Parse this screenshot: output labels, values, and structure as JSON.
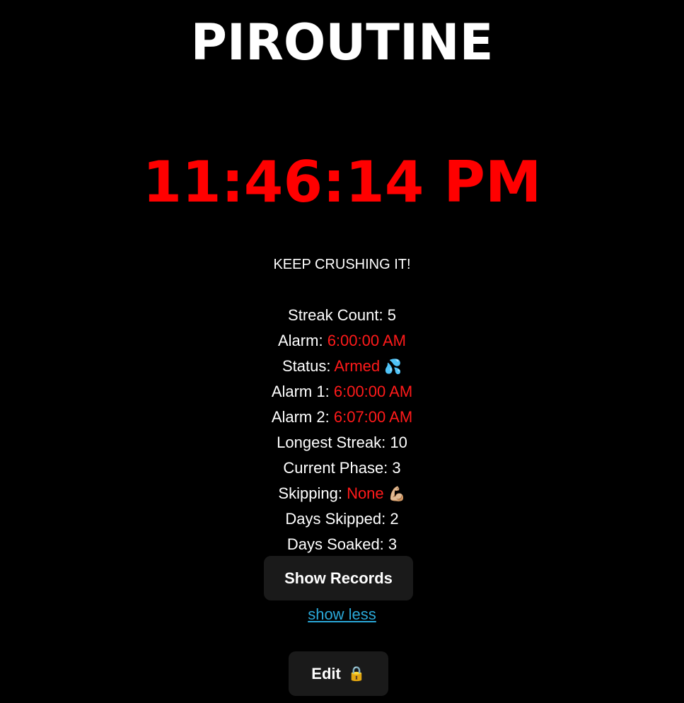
{
  "app": {
    "title": "PIROUTINE",
    "clock": "11:46:14 PM",
    "motto": "KEEP CRUSHING IT!"
  },
  "stats": {
    "streak_count": {
      "label": "Streak Count:",
      "value": "5"
    },
    "alarm": {
      "label": "Alarm:",
      "value": "6:00:00 AM"
    },
    "status": {
      "label": "Status:",
      "value": "Armed",
      "icon": "💦"
    },
    "alarm_1": {
      "label": "Alarm 1:",
      "value": "6:00:00 AM"
    },
    "alarm_2": {
      "label": "Alarm 2:",
      "value": "6:07:00 AM"
    },
    "longest_streak": {
      "label": "Longest Streak:",
      "value": "10"
    },
    "current_phase": {
      "label": "Current Phase:",
      "value": "3"
    },
    "skipping": {
      "label": "Skipping:",
      "value": "None",
      "icon": "💪🏼"
    },
    "days_skipped": {
      "label": "Days Skipped:",
      "value": "2"
    },
    "days_soaked": {
      "label": "Days Soaked:",
      "value": "3"
    }
  },
  "actions": {
    "show_records_label": "Show Records",
    "show_less_label": "show less",
    "edit_label": "Edit",
    "edit_icon": "🔒"
  },
  "colors": {
    "background": "#000000",
    "accent_red": "#ff0000",
    "link_blue": "#2aa8d8",
    "button_bg": "#1a1a1a"
  }
}
